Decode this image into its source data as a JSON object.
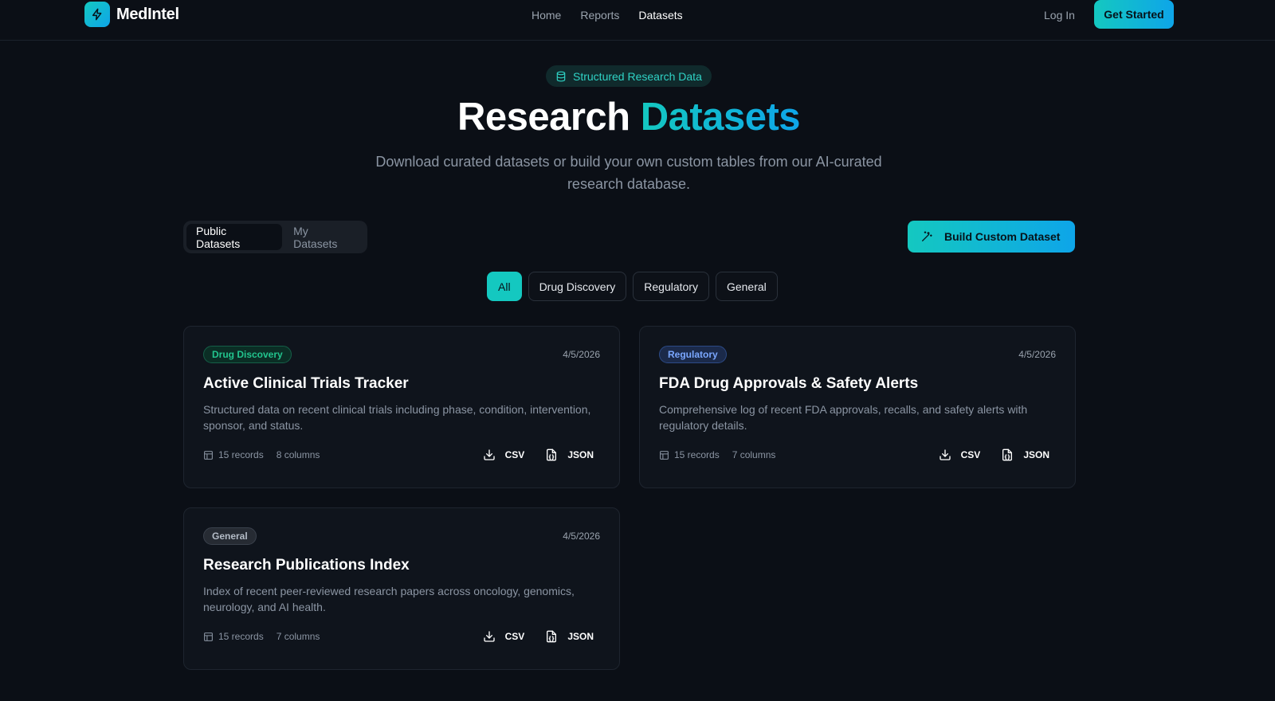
{
  "header": {
    "logo_text": "MedIntel",
    "nav": [
      "Home",
      "Reports",
      "Datasets"
    ],
    "active_nav": "Datasets",
    "login_label": "Log In",
    "get_started_label": "Get Started"
  },
  "hero": {
    "pill_label": "Structured Research Data",
    "title_plain": "Research",
    "title_accent": "Datasets",
    "subtitle": "Download curated datasets or build your own custom tables from our AI-curated research database."
  },
  "tabs": [
    "Public Datasets",
    "My Datasets"
  ],
  "active_tab": "Public Datasets",
  "build_button_label": "Build Custom Dataset",
  "filters": [
    "All",
    "Drug Discovery",
    "Regulatory",
    "General"
  ],
  "active_filter": "All",
  "datasets": [
    {
      "category": "Drug Discovery",
      "date": "4/5/2026",
      "title": "Active Clinical Trials Tracker",
      "description": "Structured data on recent clinical trials including phase, condition, intervention, sponsor, and status.",
      "records": "15 records",
      "columns": "8 columns",
      "csv_label": "CSV",
      "json_label": "JSON"
    },
    {
      "category": "Regulatory",
      "date": "4/5/2026",
      "title": "FDA Drug Approvals & Safety Alerts",
      "description": "Comprehensive log of recent FDA approvals, recalls, and safety alerts with regulatory details.",
      "records": "15 records",
      "columns": "7 columns",
      "csv_label": "CSV",
      "json_label": "JSON"
    },
    {
      "category": "General",
      "date": "4/5/2026",
      "title": "Research Publications Index",
      "description": "Index of recent peer-reviewed research papers across oncology, genomics, neurology, and AI health.",
      "records": "15 records",
      "columns": "7 columns",
      "csv_label": "CSV",
      "json_label": "JSON"
    }
  ],
  "colors": {
    "background": "#0b0f16",
    "accent_start": "#14c8c0",
    "accent_end": "#0ea5e9",
    "drug_badge": "#22c58e",
    "regulatory_badge": "#7aa7ff",
    "general_badge": "#b4bcc7"
  },
  "icons": {
    "logo": "lightning-icon",
    "pill": "database-icon",
    "build": "magic-wand-icon",
    "meta": "table-icon",
    "csv": "download-icon",
    "json": "json-file-icon"
  }
}
